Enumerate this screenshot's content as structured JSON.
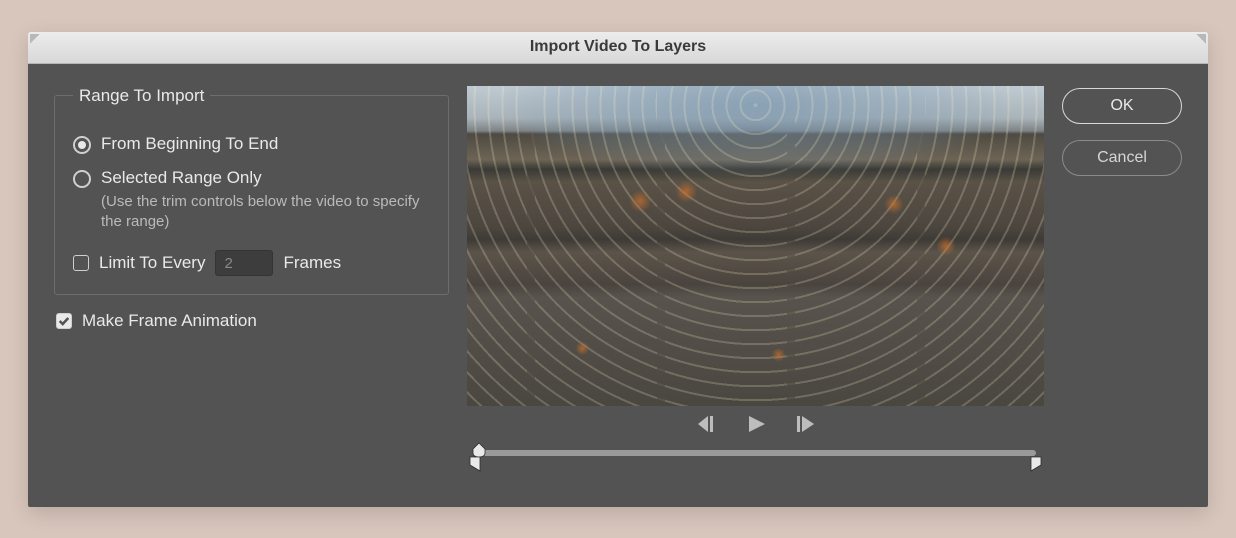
{
  "dialog": {
    "title": "Import Video To Layers"
  },
  "range": {
    "legend": "Range To Import",
    "from_beginning_label": "From Beginning To End",
    "from_beginning_selected": true,
    "selected_range_label": "Selected Range Only",
    "selected_range_hint": "(Use the trim controls below the video to specify the range)",
    "selected_range_selected": false,
    "limit_label": "Limit To Every",
    "limit_checked": false,
    "limit_value": "2",
    "limit_unit": "Frames"
  },
  "make_animation": {
    "label": "Make Frame Animation",
    "checked": true
  },
  "buttons": {
    "ok": "OK",
    "cancel": "Cancel"
  },
  "icons": {
    "step_back": "step-back-icon",
    "play": "play-icon",
    "step_fwd": "step-forward-icon"
  }
}
